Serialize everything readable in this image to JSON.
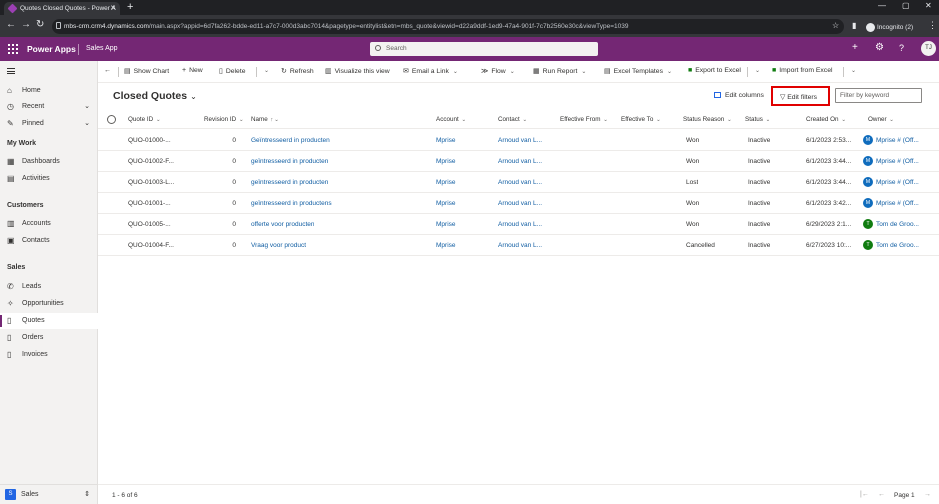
{
  "browser": {
    "tab_title": "Quotes Closed Quotes - Power A",
    "url_host": "mbs-crm.crm4.dynamics.com",
    "url_path": "/main.aspx?appid=6d7fa262-bdde-ed11-a7c7-000d3abc7014&pagetype=entitylist&etn=mbs_quote&viewid=d22a9ddf-1ed9-47a4-901f-7c7b2560e30c&viewType=1039",
    "incognito_label": "Incognito (2)"
  },
  "app": {
    "title": "Power Apps",
    "subtitle": "Sales App",
    "search_placeholder": "Search",
    "user_initials": "TJ"
  },
  "sidebar": {
    "top_items": [
      {
        "label": "Home"
      },
      {
        "label": "Recent"
      },
      {
        "label": "Pinned"
      }
    ],
    "groups": [
      {
        "title": "My Work",
        "items": [
          {
            "label": "Dashboards"
          },
          {
            "label": "Activities"
          }
        ]
      },
      {
        "title": "Customers",
        "items": [
          {
            "label": "Accounts"
          },
          {
            "label": "Contacts"
          }
        ]
      },
      {
        "title": "Sales",
        "items": [
          {
            "label": "Leads"
          },
          {
            "label": "Opportunities"
          },
          {
            "label": "Quotes"
          },
          {
            "label": "Orders"
          },
          {
            "label": "Invoices"
          }
        ]
      }
    ],
    "area": {
      "badge": "S",
      "label": "Sales"
    }
  },
  "commandbar": {
    "show_chart": "Show Chart",
    "new": "New",
    "delete": "Delete",
    "refresh": "Refresh",
    "visualize": "Visualize this view",
    "email_link": "Email a Link",
    "flow": "Flow",
    "run_report": "Run Report",
    "excel_templates": "Excel Templates",
    "export_excel": "Export to Excel",
    "import_excel": "Import from Excel"
  },
  "view": {
    "title": "Closed Quotes",
    "edit_columns": "Edit columns",
    "edit_filters": "Edit filters",
    "filter_placeholder": "Filter by keyword"
  },
  "grid": {
    "columns": [
      "Quote ID",
      "Revision ID",
      "Name",
      "Account",
      "Contact",
      "Effective From",
      "Effective To",
      "Status Reason",
      "Status",
      "Created On",
      "Owner"
    ],
    "rows": [
      {
        "quote_id": "QUO-01000-...",
        "revision": "0",
        "name": "Geïntresseerd in producten",
        "account": "Mprise",
        "contact": "Arnoud van L...",
        "reason": "Won",
        "status": "Inactive",
        "created": "6/1/2023 2:53...",
        "owner": "Mprise # (Off...",
        "owner_initial": "M",
        "owner_color": "#0f6cbd"
      },
      {
        "quote_id": "QUO-01002-F...",
        "revision": "0",
        "name": "geïntresseerd in producten",
        "account": "Mprise",
        "contact": "Arnoud van L...",
        "reason": "Won",
        "status": "Inactive",
        "created": "6/1/2023 3:44...",
        "owner": "Mprise # (Off...",
        "owner_initial": "M",
        "owner_color": "#0f6cbd"
      },
      {
        "quote_id": "QUO-01003-L...",
        "revision": "0",
        "name": "geïntresseerd in producten",
        "account": "Mprise",
        "contact": "Arnoud van L...",
        "reason": "Lost",
        "status": "Inactive",
        "created": "6/1/2023 3:44...",
        "owner": "Mprise # (Off...",
        "owner_initial": "M",
        "owner_color": "#0f6cbd"
      },
      {
        "quote_id": "QUO-01001-...",
        "revision": "0",
        "name": "geïntresseerd in productens",
        "account": "Mprise",
        "contact": "Arnoud van L...",
        "reason": "Won",
        "status": "Inactive",
        "created": "6/1/2023 3:42...",
        "owner": "Mprise # (Off...",
        "owner_initial": "M",
        "owner_color": "#0f6cbd"
      },
      {
        "quote_id": "QUO-01005-...",
        "revision": "0",
        "name": "offerte voor producten",
        "account": "Mprise",
        "contact": "Arnoud van L...",
        "reason": "Won",
        "status": "Inactive",
        "created": "6/29/2023 2:1...",
        "owner": "Tom de Groo...",
        "owner_initial": "T",
        "owner_color": "#107c10"
      },
      {
        "quote_id": "QUO-01004-F...",
        "revision": "0",
        "name": "Vraag voor product",
        "account": "Mprise",
        "contact": "Arnoud van L...",
        "reason": "Cancelled",
        "status": "Inactive",
        "created": "6/27/2023 10:...",
        "owner": "Tom de Groo...",
        "owner_initial": "T",
        "owner_color": "#107c10"
      }
    ]
  },
  "footer": {
    "count": "1 - 6 of 6",
    "page": "Page 1"
  }
}
